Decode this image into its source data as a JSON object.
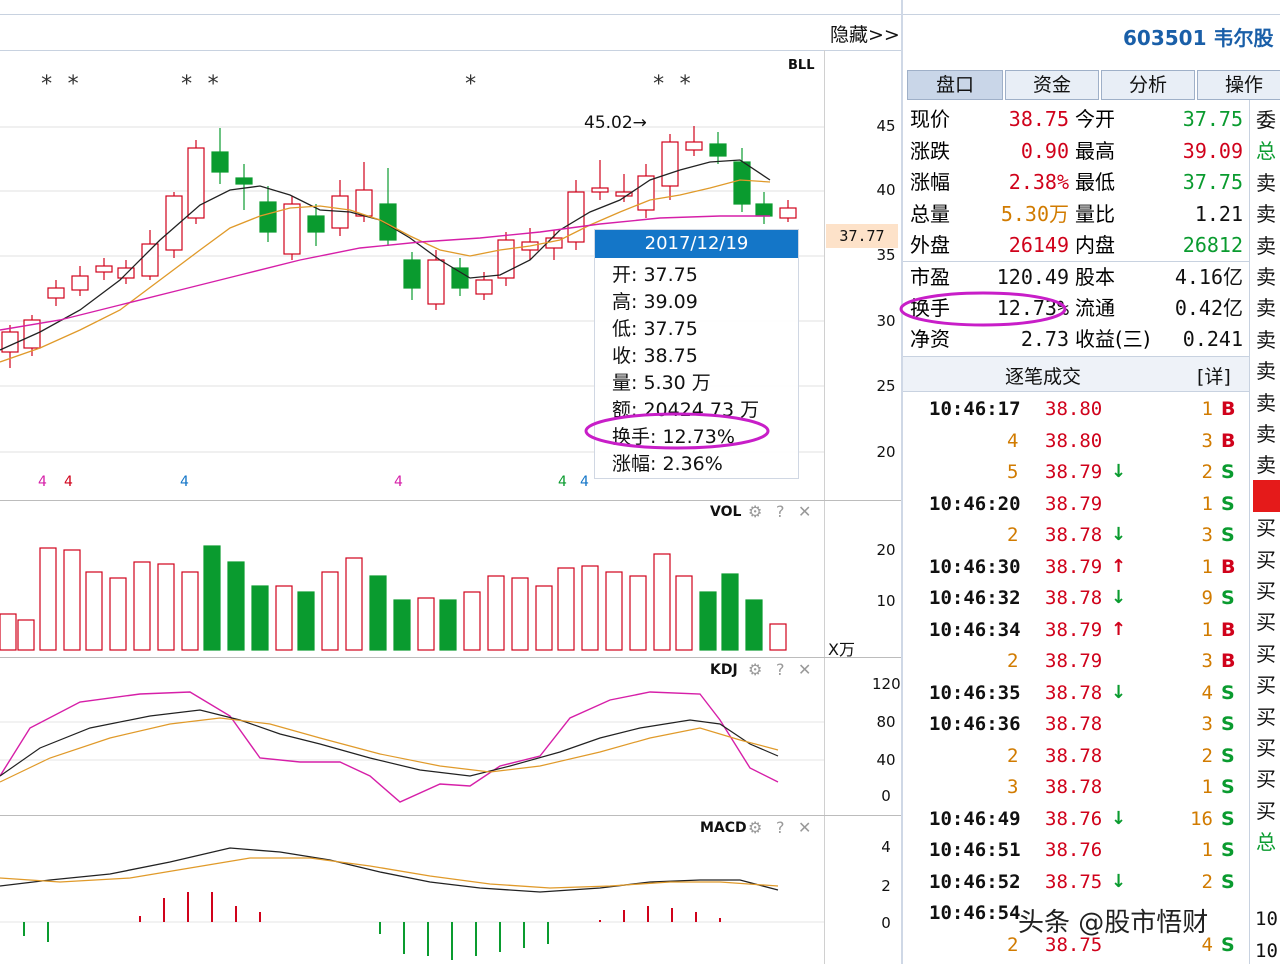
{
  "header": {
    "hide_button": "隐藏>>",
    "stock_title": "603501 韦尔股",
    "indicator_right": "BLL"
  },
  "markers": {
    "stars": [
      "* *",
      "* *",
      "*",
      "* *"
    ],
    "price_tag_high": "45.02→",
    "current_price_tag": "37.77"
  },
  "main_axis": {
    "ticks": [
      "45",
      "40",
      "35",
      "30",
      "25",
      "20"
    ]
  },
  "vol_panel": {
    "title": "VOL",
    "ticks": [
      "20",
      "10"
    ],
    "unit": "X万"
  },
  "kdj_panel": {
    "title": "KDJ",
    "ticks": [
      "120",
      "80",
      "40",
      "0"
    ]
  },
  "macd_panel": {
    "title": "MACD",
    "ticks": [
      "4",
      "2",
      "0"
    ]
  },
  "tooltip": {
    "date": "2017/12/19",
    "rows": [
      "开: 37.75",
      "高: 39.09",
      "低: 37.75",
      "收: 38.75",
      "量: 5.30 万",
      "额: 20424.73 万",
      "换手: 12.73%",
      "涨幅: 2.36%"
    ]
  },
  "tabs": [
    "盘口",
    "资金",
    "分析",
    "操作"
  ],
  "quote": [
    {
      "l1": "现价",
      "v1": "38.75",
      "l2": "今开",
      "v2": "37.75",
      "c1": "#d0021b",
      "c2": "#0a9b2f"
    },
    {
      "l1": "涨跌",
      "v1": "0.90",
      "l2": "最高",
      "v2": "39.09",
      "c1": "#d0021b",
      "c2": "#d0021b"
    },
    {
      "l1": "涨幅",
      "v1": "2.38%",
      "l2": "最低",
      "v2": "37.75",
      "c1": "#d0021b",
      "c2": "#0a9b2f"
    },
    {
      "l1": "总量",
      "v1": "5.30万",
      "l2": "量比",
      "v2": "1.21",
      "c1": "#d17b00",
      "c2": "#111111"
    },
    {
      "l1": "外盘",
      "v1": "26149",
      "l2": "内盘",
      "v2": "26812",
      "c1": "#d0021b",
      "c2": "#0a9b2f"
    },
    {
      "l1": "市盈",
      "v1": "120.49",
      "l2": "股本",
      "v2": "4.16亿",
      "c1": "#111111",
      "c2": "#111111"
    },
    {
      "l1": "换手",
      "v1": "12.73%",
      "l2": "流通",
      "v2": "0.42亿",
      "c1": "#111111",
      "c2": "#111111"
    },
    {
      "l1": "净资",
      "v1": "2.73",
      "l2": "收益(三)",
      "v2": "0.241",
      "c1": "#111111",
      "c2": "#111111"
    }
  ],
  "ticks_header": {
    "title": "逐笔成交",
    "detail": "[详]"
  },
  "ticks_list": [
    {
      "time": "10:46:17",
      "price": "38.80",
      "arrow": "",
      "vol": "1",
      "dir": "B"
    },
    {
      "time": "4",
      "price": "38.80",
      "arrow": "",
      "vol": "3",
      "dir": "B"
    },
    {
      "time": "5",
      "price": "38.79",
      "arrow": "↓",
      "vol": "2",
      "dir": "S"
    },
    {
      "time": "10:46:20",
      "price": "38.79",
      "arrow": "",
      "vol": "1",
      "dir": "S"
    },
    {
      "time": "2",
      "price": "38.78",
      "arrow": "↓",
      "vol": "3",
      "dir": "S"
    },
    {
      "time": "10:46:30",
      "price": "38.79",
      "arrow": "↑",
      "vol": "1",
      "dir": "B"
    },
    {
      "time": "10:46:32",
      "price": "38.78",
      "arrow": "↓",
      "vol": "9",
      "dir": "S"
    },
    {
      "time": "10:46:34",
      "price": "38.79",
      "arrow": "↑",
      "vol": "1",
      "dir": "B"
    },
    {
      "time": "2",
      "price": "38.79",
      "arrow": "",
      "vol": "3",
      "dir": "B"
    },
    {
      "time": "10:46:35",
      "price": "38.78",
      "arrow": "↓",
      "vol": "4",
      "dir": "S"
    },
    {
      "time": "10:46:36",
      "price": "38.78",
      "arrow": "",
      "vol": "3",
      "dir": "S"
    },
    {
      "time": "2",
      "price": "38.78",
      "arrow": "",
      "vol": "2",
      "dir": "S"
    },
    {
      "time": "3",
      "price": "38.78",
      "arrow": "",
      "vol": "1",
      "dir": "S"
    },
    {
      "time": "10:46:49",
      "price": "38.76",
      "arrow": "↓",
      "vol": "16",
      "dir": "S"
    },
    {
      "time": "10:46:51",
      "price": "38.76",
      "arrow": "",
      "vol": "1",
      "dir": "S"
    },
    {
      "time": "10:46:52",
      "price": "38.75",
      "arrow": "↓",
      "vol": "2",
      "dir": "S"
    },
    {
      "time": "10:46:54",
      "price": "",
      "arrow": "",
      "vol": "",
      "dir": ""
    },
    {
      "time": "2",
      "price": "38.75",
      "arrow": "",
      "vol": "4",
      "dir": "S"
    }
  ],
  "side_column": [
    "委",
    "总",
    "卖",
    "卖",
    "卖",
    "卖",
    "卖",
    "卖",
    "卖",
    "卖",
    "卖",
    "卖",
    "",
    "买",
    "买",
    "买",
    "买",
    "买",
    "买",
    "买",
    "买",
    "买",
    "买",
    "总"
  ],
  "side_bottom": [
    "10",
    "10"
  ],
  "watermark": "头条 @股市悟财",
  "colors": {
    "up": "#d0021b",
    "down": "#0a9b2f",
    "ma5": "#222222",
    "ma10": "#e09a2a",
    "ma20": "#d61fa8",
    "highlight": "#c81ec8",
    "tooltip_header": "#1476c8"
  }
}
